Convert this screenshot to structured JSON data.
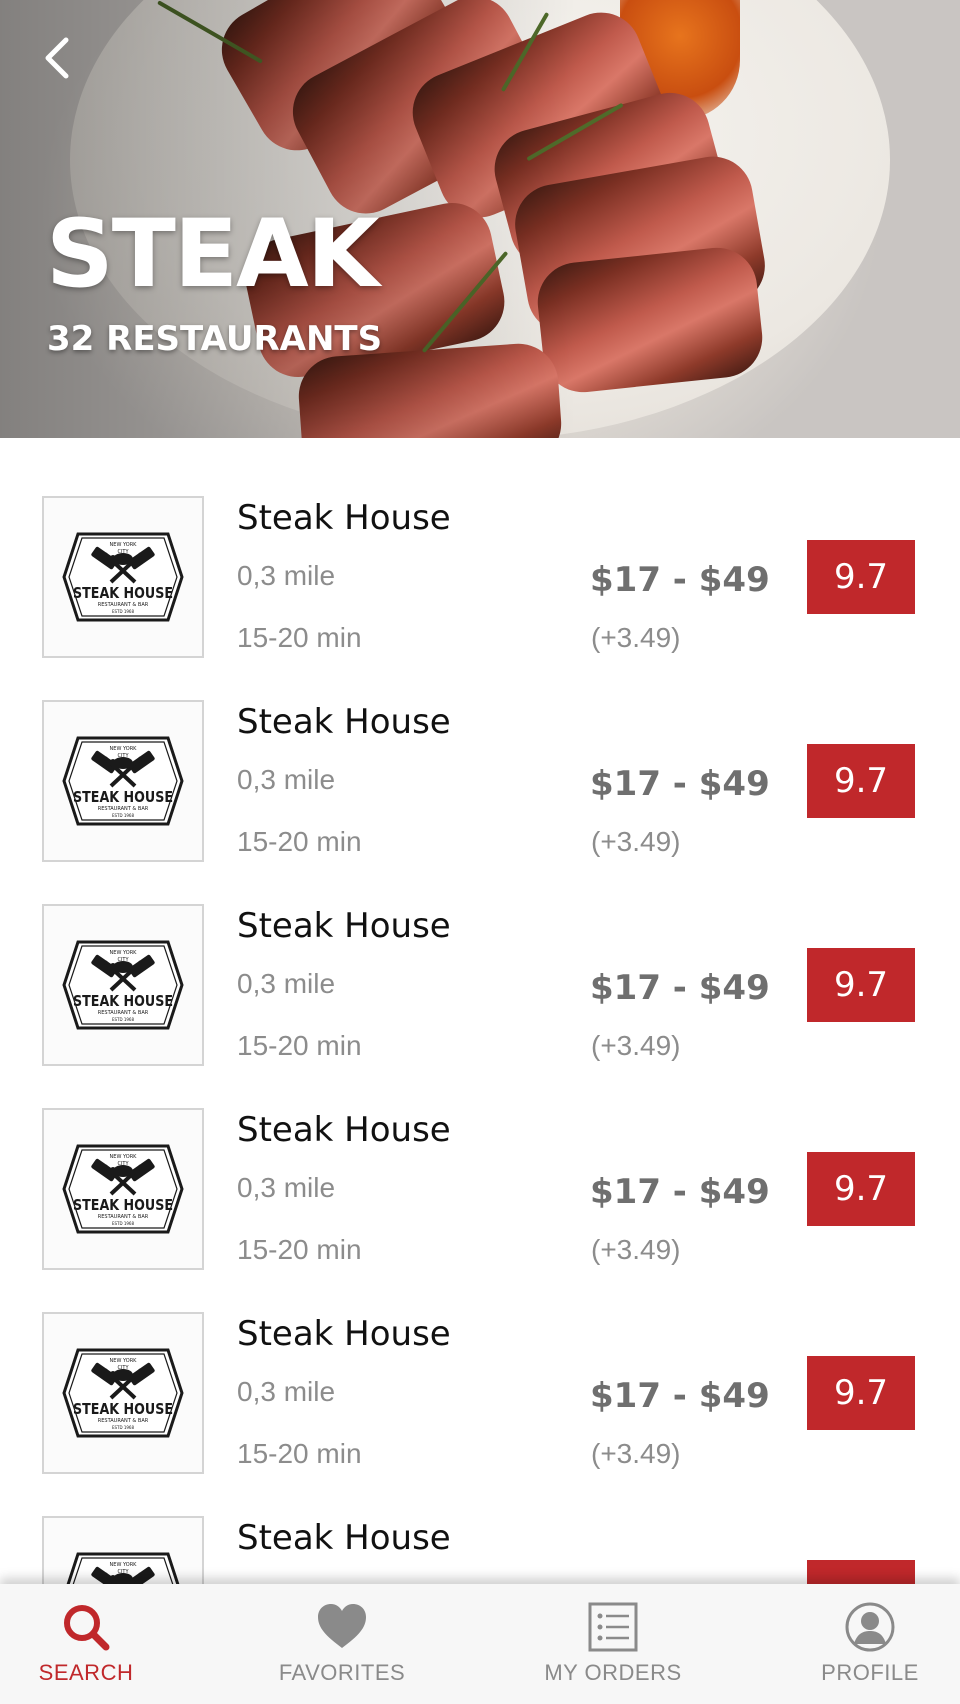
{
  "category": {
    "title": "STEAK",
    "subtitle": "32 RESTAURANTS"
  },
  "restaurants": [
    {
      "name": "Steak House",
      "distance": "0,3 mile",
      "time": "15-20 min",
      "price": "$17 - $49",
      "fee": "(+3.49)",
      "rating": "9.7"
    },
    {
      "name": "Steak House",
      "distance": "0,3 mile",
      "time": "15-20 min",
      "price": "$17 - $49",
      "fee": "(+3.49)",
      "rating": "9.7"
    },
    {
      "name": "Steak House",
      "distance": "0,3 mile",
      "time": "15-20 min",
      "price": "$17 - $49",
      "fee": "(+3.49)",
      "rating": "9.7"
    },
    {
      "name": "Steak House",
      "distance": "0,3 mile",
      "time": "15-20 min",
      "price": "$17 - $49",
      "fee": "(+3.49)",
      "rating": "9.7"
    },
    {
      "name": "Steak House",
      "distance": "0,3 mile",
      "time": "15-20 min",
      "price": "$17 - $49",
      "fee": "(+3.49)",
      "rating": "9.7"
    },
    {
      "name": "Steak House"
    }
  ],
  "logo": {
    "top": "NEW YORK",
    "city": "CITY",
    "main": "STEAK HOUSE",
    "sub": "RESTAURANT & BAR",
    "est": "ESTD 1968"
  },
  "tabs": [
    {
      "label": "SEARCH",
      "icon": "search-icon",
      "active": true
    },
    {
      "label": "FAVORITES",
      "icon": "heart-icon",
      "active": false
    },
    {
      "label": "MY ORDERS",
      "icon": "orders-list-icon",
      "active": false
    },
    {
      "label": "PROFILE",
      "icon": "profile-icon",
      "active": false
    }
  ],
  "colors": {
    "accent": "#c0282b",
    "text_muted": "#8c8c8c",
    "price": "#6f6f6f"
  }
}
